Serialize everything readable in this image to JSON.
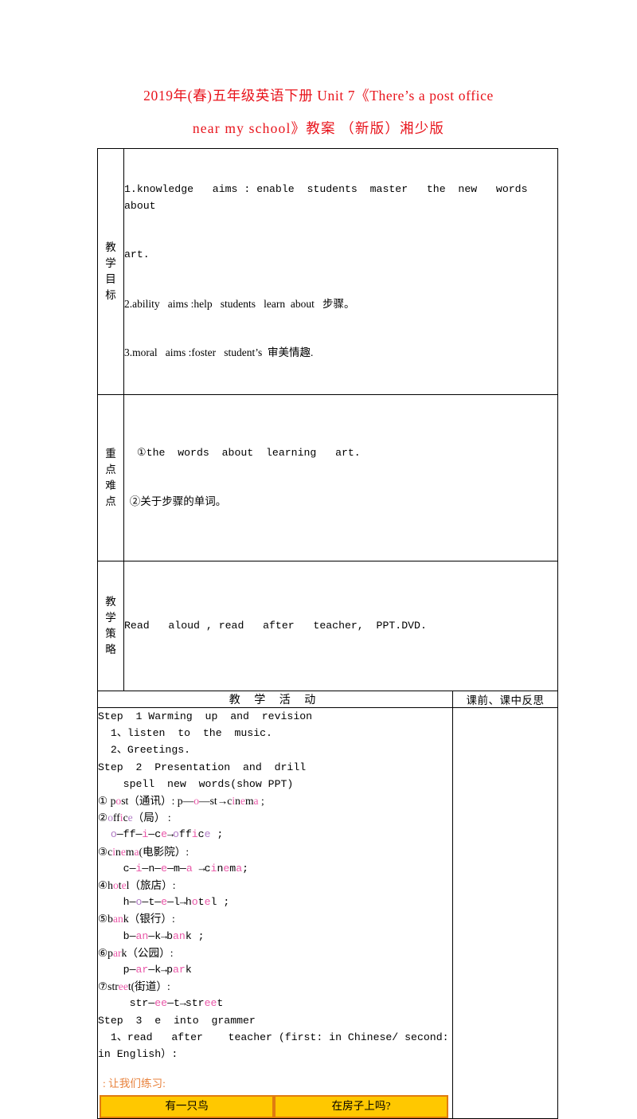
{
  "document": {
    "title_line1": "2019年(春)五年级英语下册 Unit 7《There’s a post office",
    "title_line2": "near my school》教案 （新版）湘少版",
    "title_color": "#e8141c"
  },
  "table": {
    "rows": [
      {
        "label": "教学目标",
        "label_chars": [
          "教",
          "学",
          "目",
          "标"
        ],
        "content_lines": [
          "1.knowledge   aims : enable  students  master   the  new   words  about",
          "art.",
          "2.ability   aims :help   students   learn  about   步骤。",
          "3.moral   aims :foster   student’s  审美情趣."
        ]
      },
      {
        "label": "重点难点",
        "label_chars": [
          "重",
          "点",
          "难",
          "点"
        ],
        "content_lines": [
          "  ①the  words  about  learning   art.",
          "  ②关于步骤的单词。"
        ]
      },
      {
        "label": "教学策略",
        "label_chars": [
          "教",
          "学",
          "策",
          "略"
        ],
        "content_lines": [
          "Read   aloud , read   after   teacher,  PPT.DVD."
        ]
      }
    ],
    "activity_header": "教 学 活 动",
    "reflection_header": "课前、课中反思",
    "activity_lines": [
      {
        "id": "l1",
        "text": "Step  1 Warming  up  and  revision"
      },
      {
        "id": "l2",
        "text": "  1、listen  to  the  music."
      },
      {
        "id": "l3",
        "text": "  2、Greetings."
      },
      {
        "id": "l4",
        "text": "Step  2  Presentation  and  drill"
      },
      {
        "id": "l5",
        "text": "    spell  new  words(show PPT)"
      },
      {
        "id": "l6",
        "text": "① post（通讯）: p—o—st→cinema ;"
      },
      {
        "id": "l7",
        "text": "②office（局） :"
      },
      {
        "id": "l8",
        "text": "  o—ff—i—ce→office ;"
      },
      {
        "id": "l9",
        "text": "③cinema(电影院）:"
      },
      {
        "id": "l10",
        "text": "    c—i—n—e—m—a →cinema;"
      },
      {
        "id": "l11",
        "text": "④hotel（旅店）:"
      },
      {
        "id": "l12",
        "text": "    h—o—t—e—l→hotel ;"
      },
      {
        "id": "l13",
        "text": "⑤bank（银行）:"
      },
      {
        "id": "l14",
        "text": "    b—an—k→bank ;"
      },
      {
        "id": "l15",
        "text": "⑥park（公园）:"
      },
      {
        "id": "l16",
        "text": "    p—ar—k→park"
      },
      {
        "id": "l17",
        "text": "⑦street(街道）:"
      },
      {
        "id": "l18",
        "text": "     str—ee—t→street"
      },
      {
        "id": "l19",
        "text": "Step  3  e  into  grammer"
      },
      {
        "id": "l20",
        "text": "  1、read   after    teacher (first: in Chinese/ second:"
      },
      {
        "id": "l21",
        "text": "in English）:"
      }
    ],
    "practice_label": ": 让我们练习:",
    "answer_boxes": [
      {
        "text": "有一只鸟"
      },
      {
        "text": "在房子上吗?"
      }
    ],
    "colors": {
      "pink": "#e957a8",
      "plum": "#b07ac4",
      "box_fill": "#ffc800",
      "box_border": "#e07b10",
      "practice_label": "#e8823c"
    }
  }
}
